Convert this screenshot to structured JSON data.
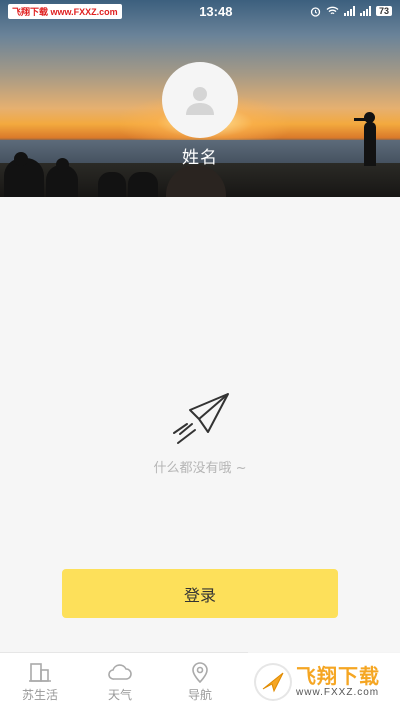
{
  "status_bar": {
    "left_label": "飞翔下载 www.FXXZ.com",
    "time": "13:48",
    "battery": "73"
  },
  "profile": {
    "name": "姓名"
  },
  "empty_state": {
    "message": "什么都没有哦 ~"
  },
  "login": {
    "label": "登录"
  },
  "bottom_nav": {
    "items": [
      {
        "label": "苏生活",
        "icon": "city-icon"
      },
      {
        "label": "天气",
        "icon": "cloud-icon"
      },
      {
        "label": "导航",
        "icon": "location-pin-icon"
      }
    ]
  },
  "watermark": {
    "title": "飞翔下载",
    "url": "www.FXXZ.com"
  },
  "colors": {
    "accent": "#fde05a",
    "nav_text": "#999999",
    "empty_text": "#b5b5b5"
  }
}
